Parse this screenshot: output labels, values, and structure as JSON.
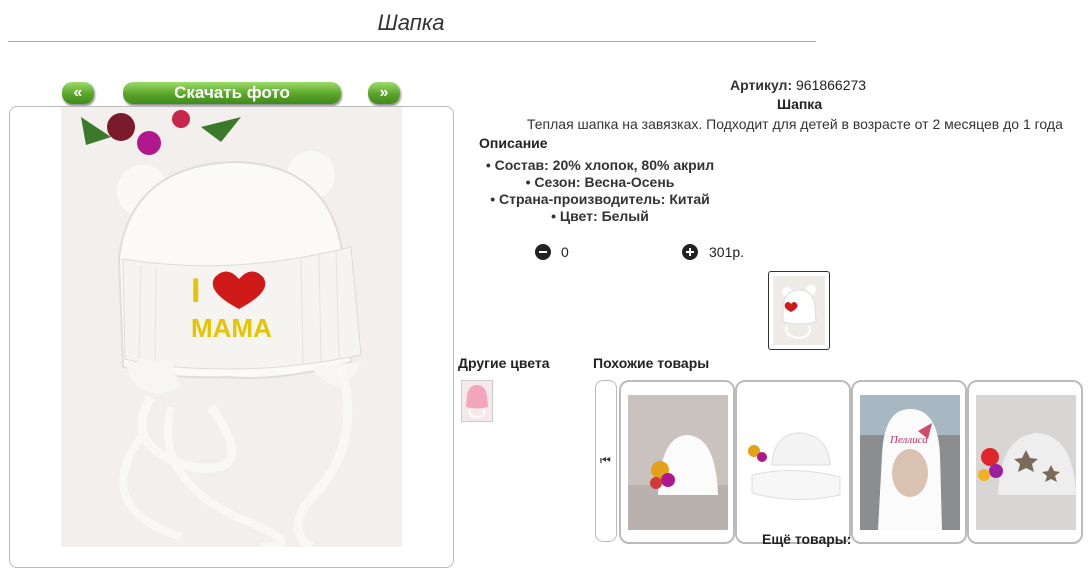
{
  "page": {
    "title": "Шапка"
  },
  "photo": {
    "prev_label": "«",
    "download_label": "Скачать фото",
    "next_label": "»"
  },
  "product": {
    "article_label": "Артикул:",
    "article_value": "961866273",
    "name": "Шапка",
    "description": "Теплая шапка на завязках. Подходит для детей в возрасте от 2 месяцев до 1 года",
    "description_heading": "Описание",
    "properties": [
      "Состав: 20% хлопок, 80% акрил",
      "Сезон: Весна-Осень",
      "Страна-производитель: Китай",
      "Цвет: Белый"
    ],
    "embroidery_line1": "I",
    "embroidery_line2": "MAMA"
  },
  "cart": {
    "quantity": "0",
    "price": "301р."
  },
  "other_colors": {
    "label": "Другие цвета"
  },
  "similar": {
    "label": "Похожие товары",
    "more_label": "Ещё товары:",
    "card3_text": "Пеллиса"
  },
  "colors": {
    "button_green": "#5aa52a",
    "heart_red": "#d01a1a",
    "embroidery_yellow": "#e6c400"
  }
}
